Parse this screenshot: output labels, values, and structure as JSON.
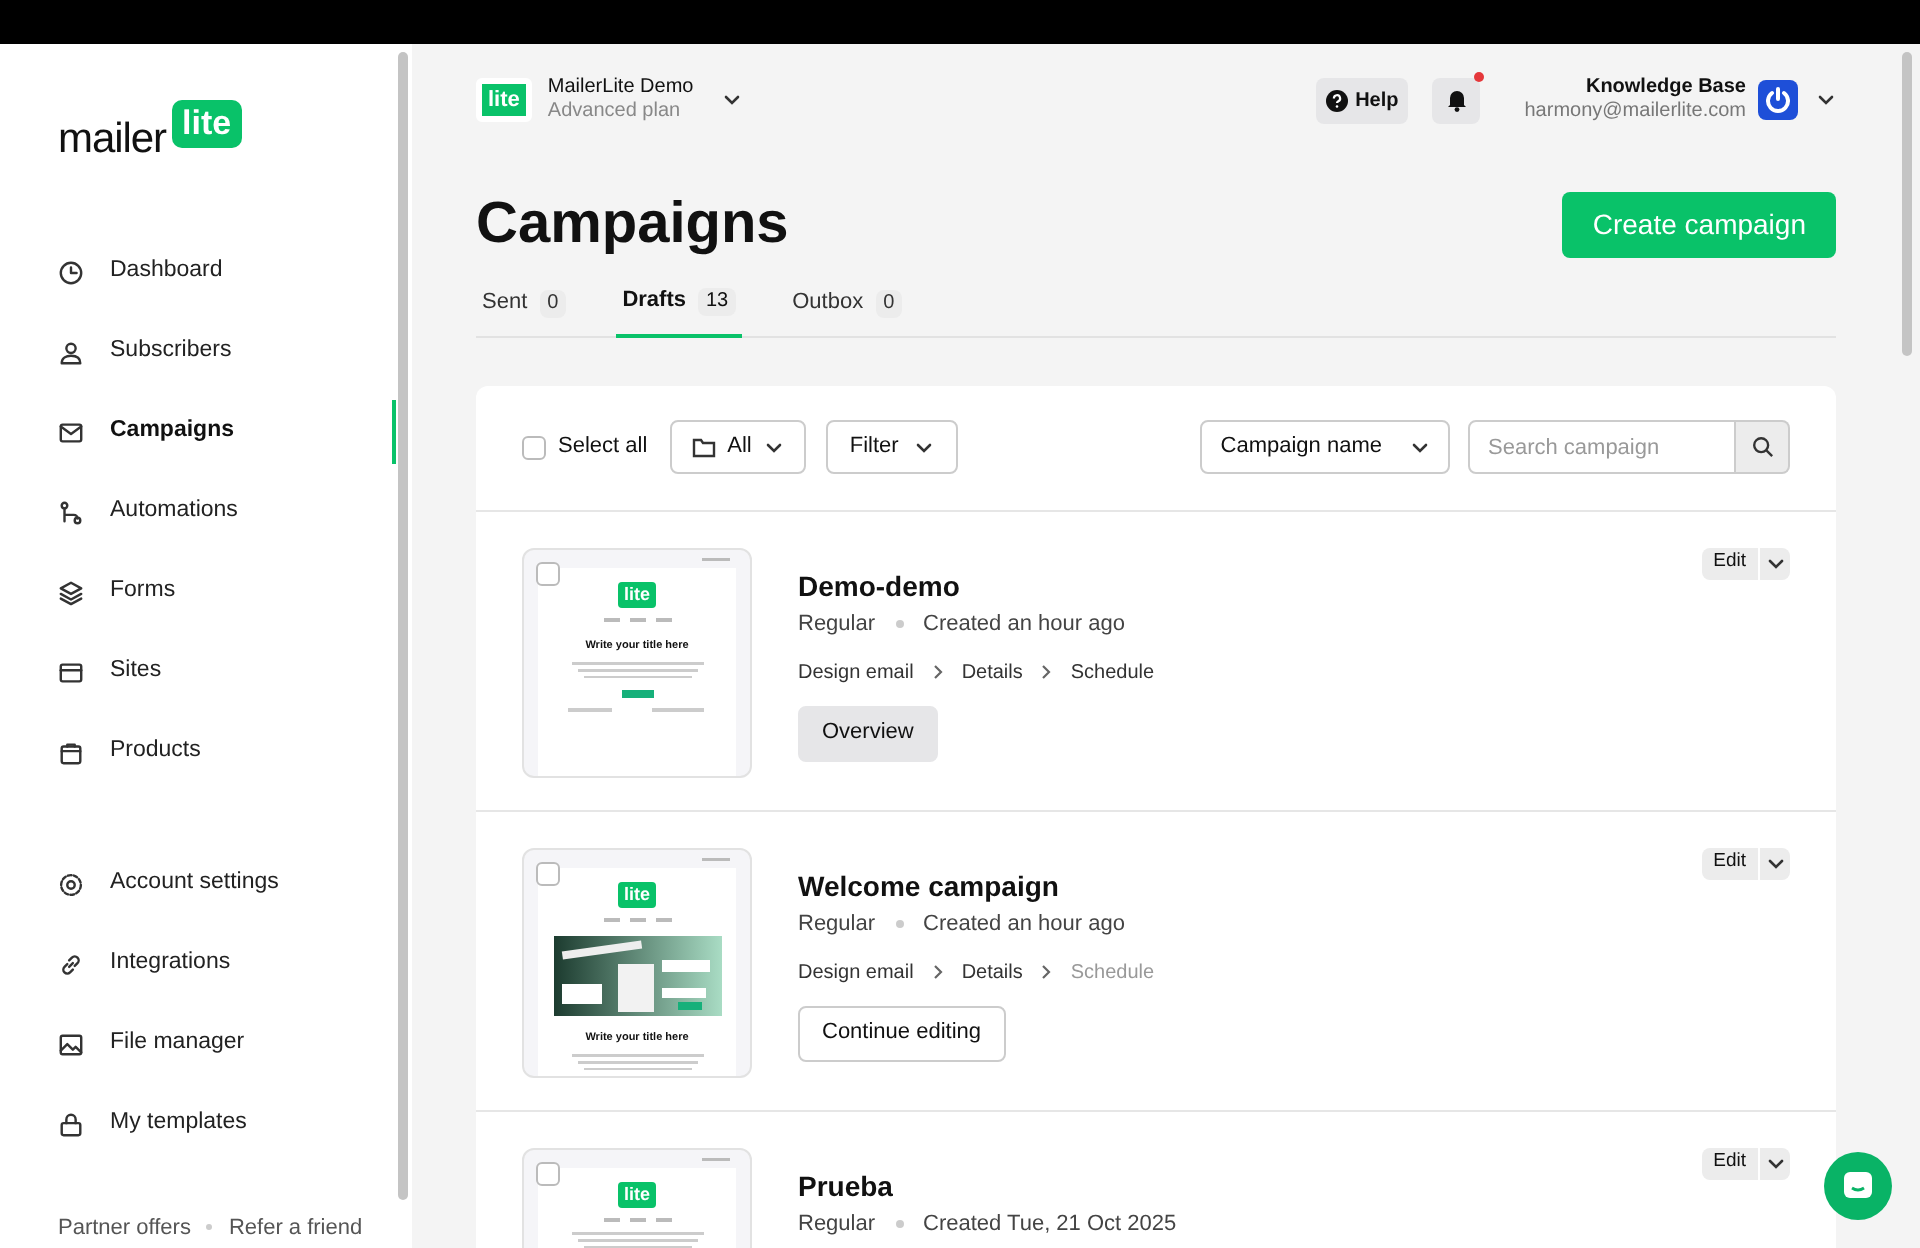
{
  "sidebar": {
    "logo": {
      "word": "mailer",
      "badge": "lite"
    },
    "items": [
      {
        "label": "Dashboard",
        "selected": false
      },
      {
        "label": "Subscribers",
        "selected": false
      },
      {
        "label": "Campaigns",
        "selected": true
      },
      {
        "label": "Automations",
        "selected": false
      },
      {
        "label": "Forms",
        "selected": false
      },
      {
        "label": "Sites",
        "selected": false
      },
      {
        "label": "Products",
        "selected": false
      }
    ],
    "settings_items": [
      {
        "label": "Account settings",
        "selected": false
      },
      {
        "label": "Integrations",
        "selected": false
      },
      {
        "label": "File manager",
        "selected": false
      },
      {
        "label": "My templates",
        "selected": false
      }
    ],
    "footer_links": [
      "Partner offers",
      "Refer a friend"
    ]
  },
  "header": {
    "account": {
      "badge": "lite",
      "name": "MailerLite Demo",
      "plan": "Advanced plan"
    },
    "help": "Help",
    "notification_unread": true,
    "user": {
      "name": "Knowledge Base",
      "email": "harmony@mailerlite.com"
    }
  },
  "page_title": "Campaigns",
  "create_button": "Create campaign",
  "tabs": [
    {
      "label": "Sent",
      "count": "0",
      "selected": false
    },
    {
      "label": "Drafts",
      "count": "13",
      "selected": true
    },
    {
      "label": "Outbox",
      "count": "0",
      "selected": false
    }
  ],
  "toolbar": {
    "select_all": {
      "label": "Select all",
      "checked": false
    },
    "folder": "All",
    "filter": "Filter",
    "sort": "Campaign name",
    "search": {
      "placeholder": "Search campaign"
    }
  },
  "campaigns": [
    {
      "name": "Demo-demo",
      "type": "Regular",
      "created": "Created an hour ago",
      "checked": false,
      "steps": [
        {
          "label": "Design email",
          "done": true
        },
        {
          "label": "Details",
          "done": true
        },
        {
          "label": "Schedule",
          "done": true
        }
      ],
      "action": {
        "label": "Overview",
        "kind": "filled"
      },
      "edit": "Edit",
      "preview": {
        "kind": "plain",
        "logo": "lite",
        "title": "Write your title here"
      }
    },
    {
      "name": "Welcome campaign",
      "type": "Regular",
      "created": "Created an hour ago",
      "checked": false,
      "steps": [
        {
          "label": "Design email",
          "done": true
        },
        {
          "label": "Details",
          "done": true
        },
        {
          "label": "Schedule",
          "done": false
        }
      ],
      "action": {
        "label": "Continue editing",
        "kind": "outline"
      },
      "edit": "Edit",
      "preview": {
        "kind": "hero",
        "logo": "lite",
        "title": "Write your title here"
      }
    },
    {
      "name": "Prueba",
      "type": "Regular",
      "created": "Created Tue, 21 Oct 2025",
      "checked": false,
      "edit": "Edit",
      "preview": {
        "kind": "plain",
        "logo": "lite"
      }
    }
  ]
}
